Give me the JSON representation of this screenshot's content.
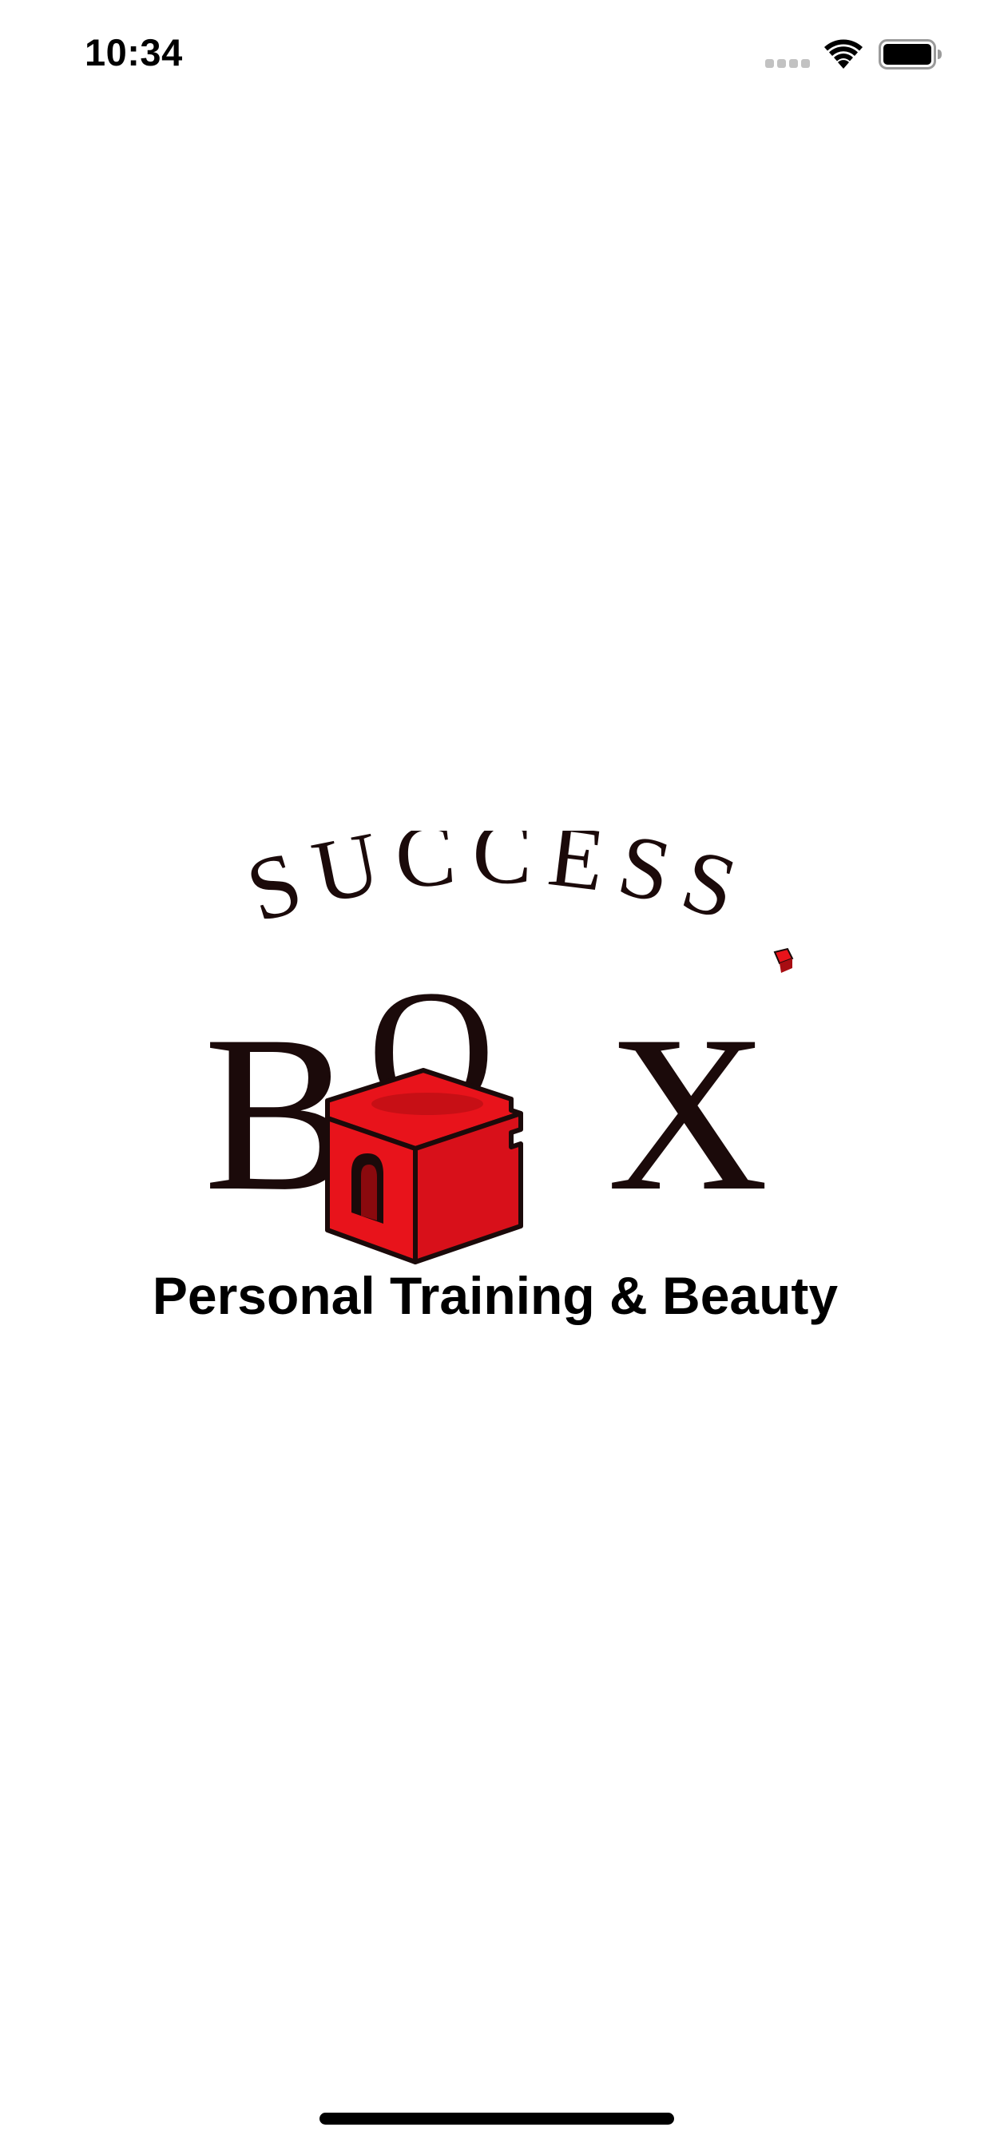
{
  "status_bar": {
    "time": "10:34",
    "icons": [
      "cellular-signal-icon",
      "wifi-icon",
      "battery-icon"
    ]
  },
  "logo": {
    "top_text": "SUCCESS",
    "main_letters": [
      "B",
      "O",
      "X"
    ],
    "tagline": "Personal Training & Beauty",
    "colors": {
      "ink": "#1b0a0a",
      "accent_red": "#e8131b",
      "dark_red": "#8a0a0e"
    }
  },
  "colors": {
    "background": "#ffffff",
    "status_text": "#000000",
    "inactive_signal": "#c2c2c2"
  }
}
